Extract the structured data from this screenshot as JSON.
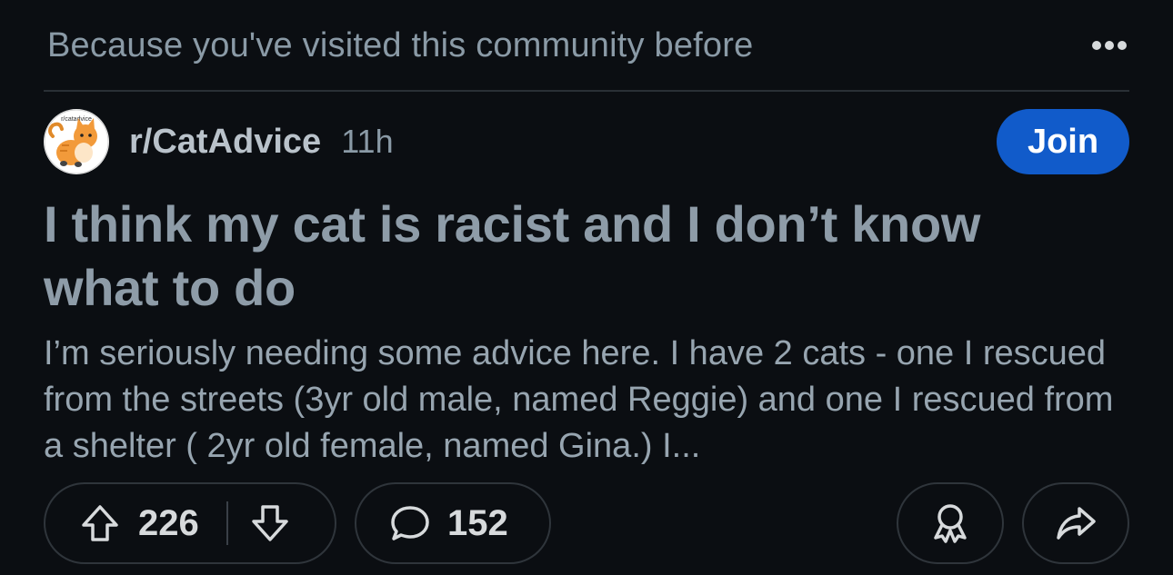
{
  "feed_reason": "Because you've visited this community before",
  "post": {
    "community": "r/CatAdvice",
    "age": "11h",
    "avatar_text": "r/catadvice",
    "join_label": "Join",
    "title": "I think my cat is racist and I don’t know what to do",
    "body": "I’m seriously needing some advice here. I have 2 cats - one I rescued from the streets (3yr old male, named Reggie) and one I rescued from a shelter ( 2yr old female, named Gina.) I..."
  },
  "actions": {
    "vote_count": "226",
    "comment_count": "152"
  },
  "icons": {
    "more": "more-horizontal-icon",
    "upvote": "arrow-up-icon",
    "downvote": "arrow-down-icon",
    "comment": "speech-bubble-icon",
    "award": "award-ribbon-icon",
    "share": "share-arrow-icon"
  },
  "colors": {
    "background": "#0b0e12",
    "join_button": "#115bca",
    "muted_text": "#8a9aa6"
  }
}
